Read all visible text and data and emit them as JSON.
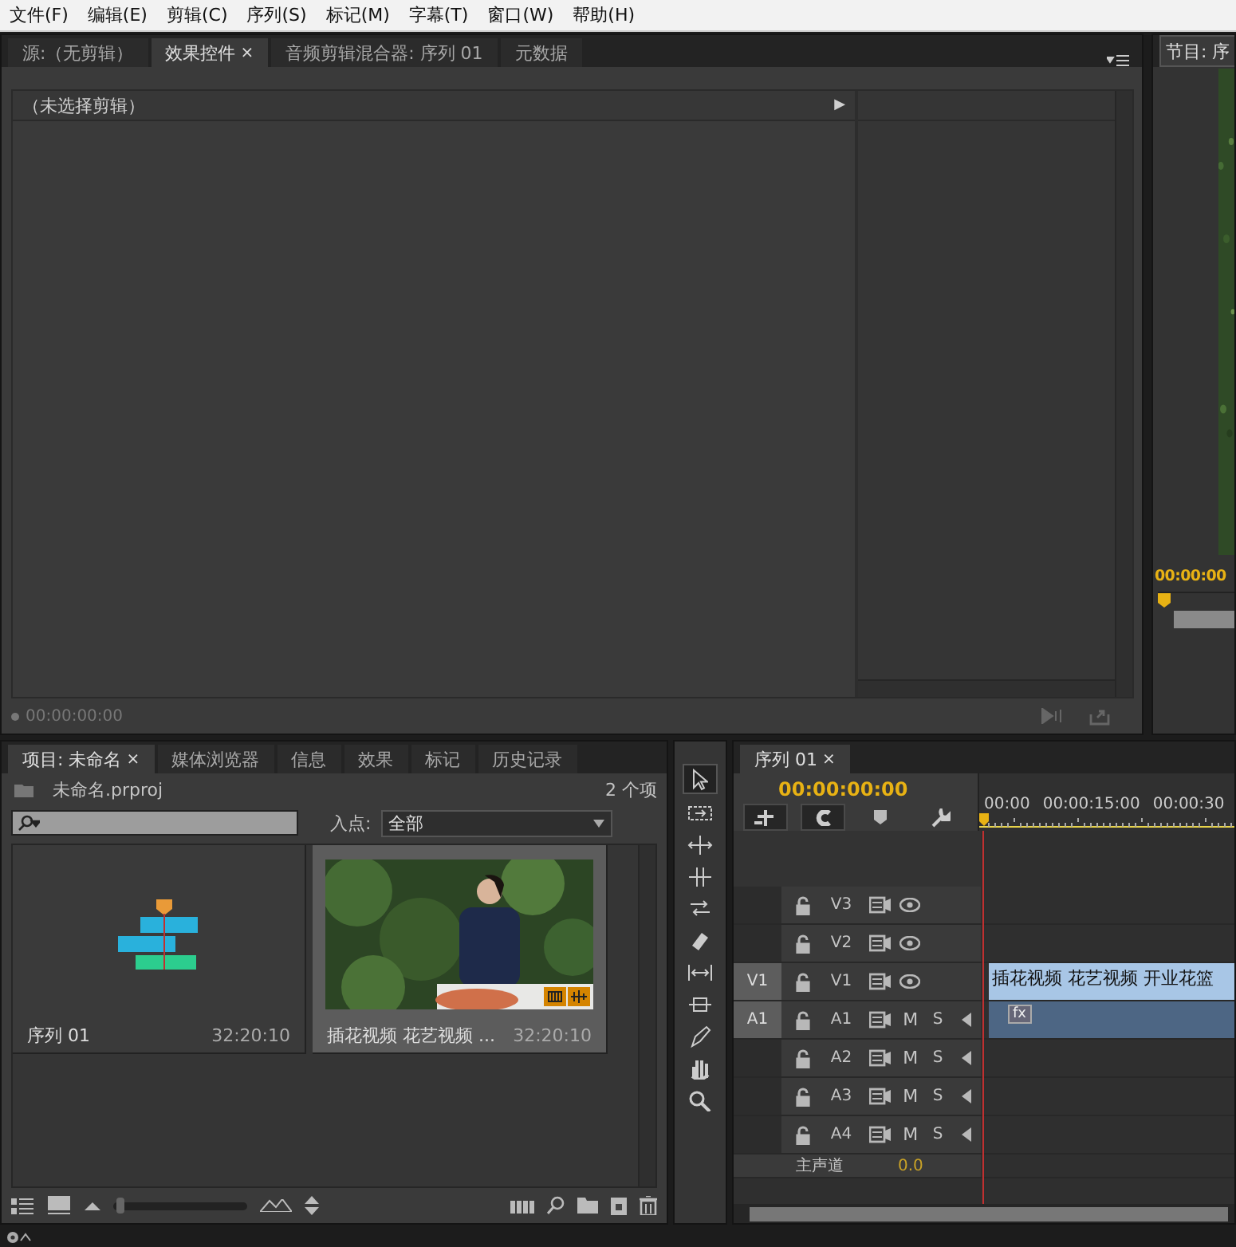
{
  "menu": [
    {
      "label": "文件(F)"
    },
    {
      "label": "编辑(E)"
    },
    {
      "label": "剪辑(C)"
    },
    {
      "label": "序列(S)"
    },
    {
      "label": "标记(M)"
    },
    {
      "label": "字幕(T)"
    },
    {
      "label": "窗口(W)"
    },
    {
      "label": "帮助(H)"
    }
  ],
  "effects_panel": {
    "tabs": [
      {
        "label": "源:（无剪辑）",
        "selected": false
      },
      {
        "label": "效果控件",
        "selected": true,
        "close": "×"
      },
      {
        "label": "音频剪辑混合器: 序列 01",
        "selected": false
      },
      {
        "label": "元数据",
        "selected": false
      }
    ],
    "clip_header": "（未选择剪辑）",
    "expand": "▶",
    "timecode": "00:00:00:00"
  },
  "program_panel": {
    "tab": "节目: 序",
    "timecode": "00:00:00"
  },
  "project_panel": {
    "tabs": [
      {
        "label": "项目: 未命名",
        "selected": true,
        "close": "×"
      },
      {
        "label": "媒体浏览器",
        "selected": false
      },
      {
        "label": "信息",
        "selected": false
      },
      {
        "label": "效果",
        "selected": false
      },
      {
        "label": "标记",
        "selected": false
      },
      {
        "label": "历史记录",
        "selected": false
      }
    ],
    "file": "未命名.prproj",
    "count": "2 个项",
    "in_point_label": "入点:",
    "in_point_value": "全部",
    "zoom": {
      "level": 0.02
    },
    "items": [
      {
        "kind": "sequence",
        "name": "序列 01",
        "duration": "32:20:10",
        "selected": false
      },
      {
        "kind": "clip",
        "name": "插花视频 花艺视频 ...",
        "duration": "32:20:10",
        "selected": true
      }
    ]
  },
  "timeline": {
    "tab": "序列 01",
    "close": "×",
    "timecode": "00:00:00:00",
    "ruler": [
      "00:00",
      "00:00:15:00",
      "00:00:30"
    ],
    "tracks": [
      {
        "kind": "video",
        "name": "V3"
      },
      {
        "kind": "video",
        "name": "V2"
      },
      {
        "kind": "video",
        "name": "V1",
        "source": "V1",
        "clip": "插花视频 花艺视频 开业花篮"
      },
      {
        "kind": "audio",
        "name": "A1",
        "source": "A1",
        "mute": "M",
        "solo": "S",
        "clip_badge": "fx"
      },
      {
        "kind": "audio",
        "name": "A2",
        "mute": "M",
        "solo": "S"
      },
      {
        "kind": "audio",
        "name": "A3",
        "mute": "M",
        "solo": "S"
      },
      {
        "kind": "audio",
        "name": "A4",
        "mute": "M",
        "solo": "S"
      },
      {
        "kind": "master",
        "name": "主声道",
        "value": "0.0"
      }
    ]
  }
}
